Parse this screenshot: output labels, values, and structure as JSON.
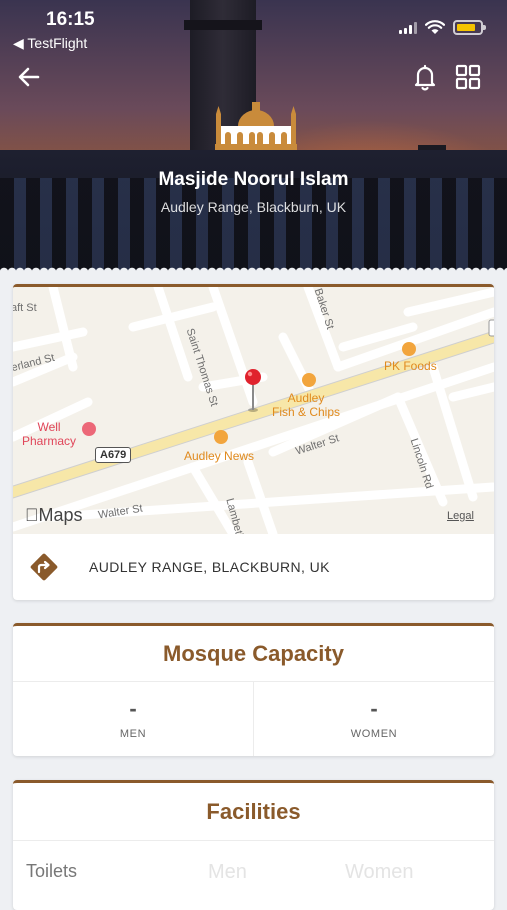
{
  "status_bar": {
    "time": "16:15",
    "back_app": "◀ TestFlight"
  },
  "header": {
    "mosque_name": "Masjide Noorul Islam",
    "mosque_address": "Audley Range, Blackburn, UK"
  },
  "map": {
    "street_labels": [
      "aft St",
      "erland St",
      "Saint Thomas St",
      "Baker St",
      "Walter St",
      "Walter St",
      "Lambeth",
      "Lincoln Rd"
    ],
    "pois": {
      "pk_foods": "PK Foods",
      "audley_fish": "Audley\nFish & Chips",
      "audley_news": "Audley News",
      "pharmacy": "Well\nPharmacy"
    },
    "road_badge": "A679",
    "maps_brand": "Maps",
    "legal": "Legal"
  },
  "address_row": {
    "text": "AUDLEY RANGE, BLACKBURN, UK"
  },
  "capacity": {
    "title": "Mosque Capacity",
    "men_value": "-",
    "men_label": "MEN",
    "women_value": "-",
    "women_label": "WOMEN"
  },
  "facilities": {
    "title": "Facilities",
    "row_label": "Toilets",
    "men": "Men",
    "women": "Women"
  },
  "colors": {
    "accent": "#8a5a2b",
    "poi_orange": "#e08a1e",
    "pin_red": "#e0222d"
  }
}
